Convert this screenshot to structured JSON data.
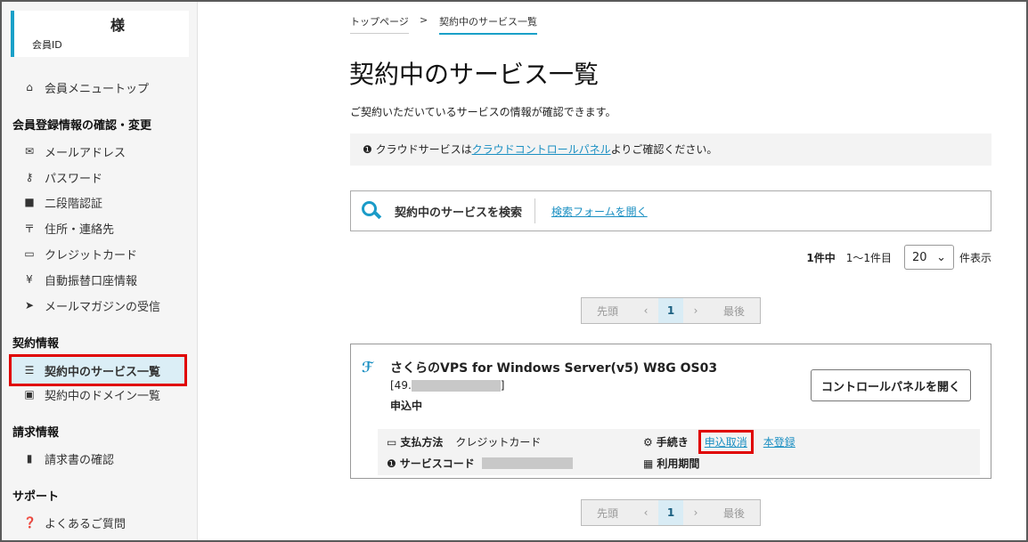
{
  "sidebar": {
    "user": {
      "sama": "様",
      "member_id_label": "会員ID"
    },
    "top_link": "会員メニュートップ",
    "sections": [
      {
        "title": "会員登録情報の確認・変更"
      },
      {
        "title": "契約情報"
      },
      {
        "title": "請求情報"
      },
      {
        "title": "サポート"
      }
    ],
    "account_items": [
      {
        "label": "メールアドレス",
        "icon": "envelope-icon"
      },
      {
        "label": "パスワード",
        "icon": "key-icon"
      },
      {
        "label": "二段階認証",
        "icon": "lock-icon"
      },
      {
        "label": "住所・連絡先",
        "icon": "postal-mark-icon"
      },
      {
        "label": "クレジットカード",
        "icon": "credit-card-icon"
      },
      {
        "label": "自動振替口座情報",
        "icon": "yen-icon"
      },
      {
        "label": "メールマガジンの受信",
        "icon": "paper-plane-icon"
      }
    ],
    "contract_items": [
      {
        "label": "契約中のサービス一覧",
        "icon": "server-icon"
      },
      {
        "label": "契約中のドメイン一覧",
        "icon": "window-icon"
      }
    ],
    "billing_items": [
      {
        "label": "請求書の確認",
        "icon": "document-icon"
      }
    ],
    "support_items": [
      {
        "label": "よくあるご質問",
        "icon": "question-icon"
      }
    ]
  },
  "breadcrumb": {
    "home": "トップページ",
    "separator": ">",
    "current": "契約中のサービス一覧"
  },
  "page": {
    "title": "契約中のサービス一覧",
    "description": "ご契約いただいているサービスの情報が確認できます。",
    "info_prefix": "クラウドサービスは",
    "info_link": "クラウドコントロールパネル",
    "info_suffix": "よりご確認ください。"
  },
  "search": {
    "label": "契約中のサービスを検索",
    "open_link": "検索フォームを開く"
  },
  "count": {
    "total": "1件中",
    "range": "1〜1件目",
    "per_page": "20",
    "per_page_suffix": "件表示"
  },
  "pager": {
    "first": "先頭",
    "prev": "‹",
    "current": "1",
    "next": "›",
    "last": "最後"
  },
  "service": {
    "name": "さくらのVPS for Windows Server(v5) W8G OS03",
    "ip_prefix": "[49.",
    "ip_suffix": "]",
    "status": "申込中",
    "control_panel_button": "コントロールパネルを開く",
    "payment_label": "支払方法",
    "payment_value": "クレジットカード",
    "service_code_label": "サービスコード",
    "procedure_label": "手続き",
    "cancel_link": "申込取消",
    "register_link": "本登録",
    "period_label": "利用期間"
  },
  "colors": {
    "accent": "#1a9bc8",
    "highlight": "#e00000",
    "active_bg": "#dbeef6"
  }
}
